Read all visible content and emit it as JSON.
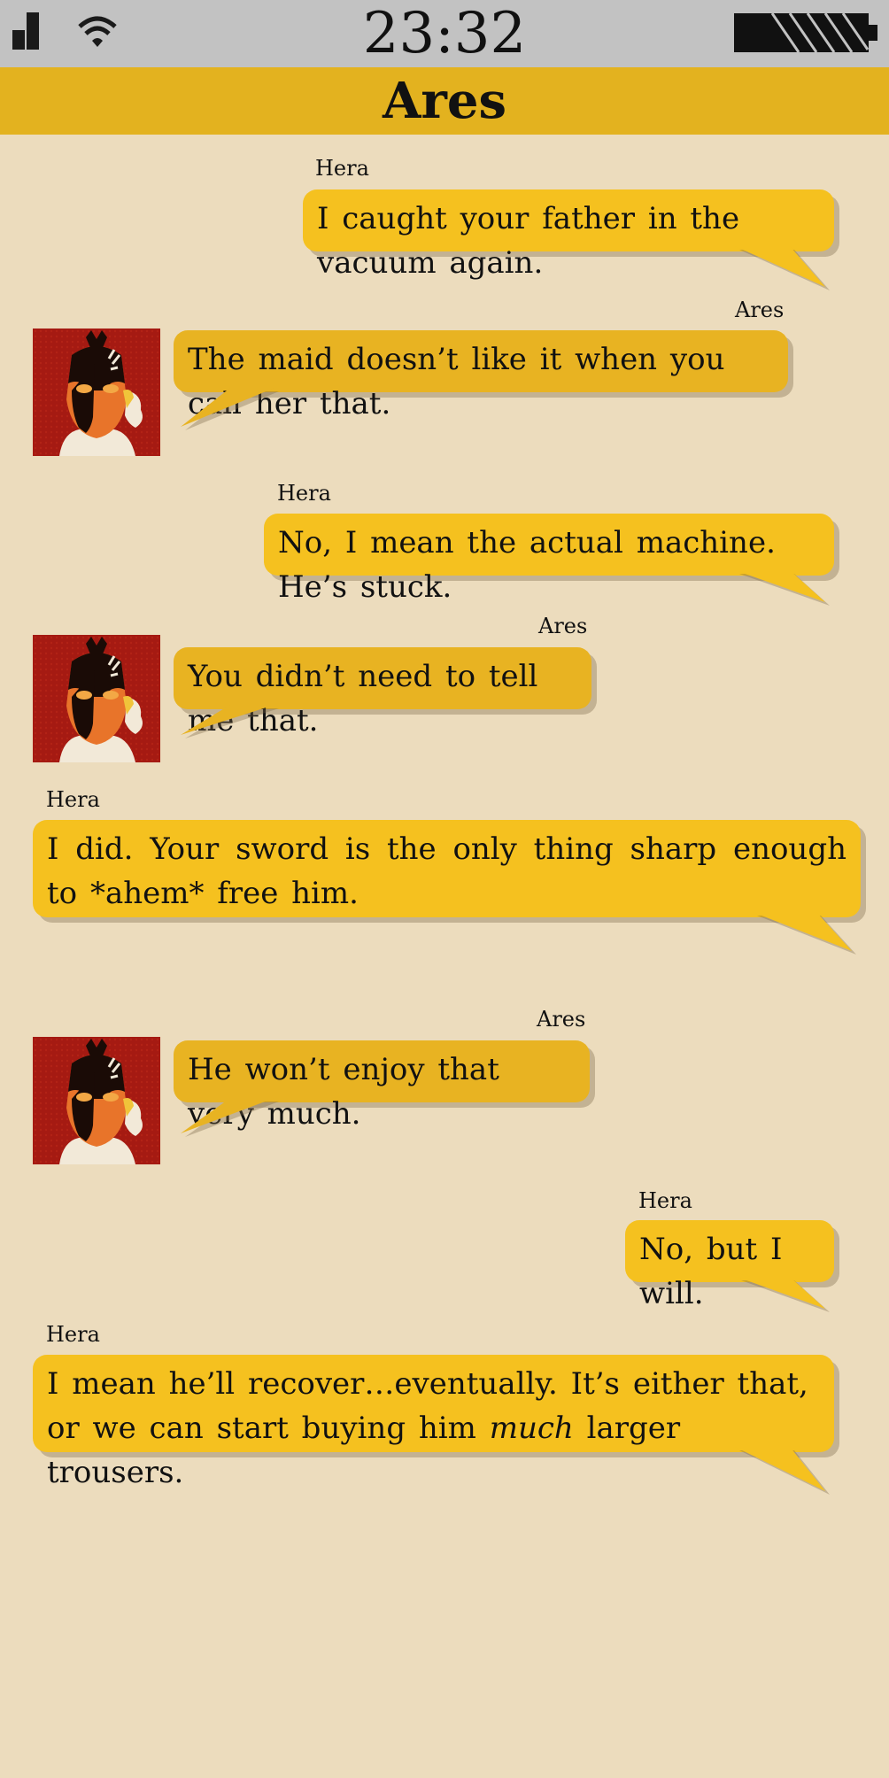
{
  "status_bar": {
    "time": "23:32",
    "signal_icon": "signal-icon",
    "wifi_icon": "wifi-icon",
    "battery_icon": "battery-icon"
  },
  "header": {
    "title": "Ares"
  },
  "colors": {
    "background": "#ecdcbd",
    "status_bar": "#c2c2c2",
    "header": "#e3b21f",
    "bubble_hera": "#f5c11f",
    "bubble_ares": "#e8b322"
  },
  "messages": [
    {
      "sender": "Hera",
      "text": "I caught your father in the vacuum again."
    },
    {
      "sender": "Ares",
      "text": "The maid doesn’t like it when you call her that."
    },
    {
      "sender": "Hera",
      "text": "No, I mean the actual machine. He’s stuck."
    },
    {
      "sender": "Ares",
      "text": "You didn’t need to tell me that."
    },
    {
      "sender": "Hera",
      "text": "I did. Your sword is the only thing sharp enough to *ahem* free him."
    },
    {
      "sender": "Ares",
      "text": "He won’t enjoy that very much."
    },
    {
      "sender": "Hera",
      "text": "No, but I will."
    },
    {
      "sender": "Hera",
      "text_before": "I mean he’ll recover…eventually. It’s either that, or we can start buying him ",
      "text_emphasis": "much",
      "text_after": " larger trousers."
    }
  ]
}
